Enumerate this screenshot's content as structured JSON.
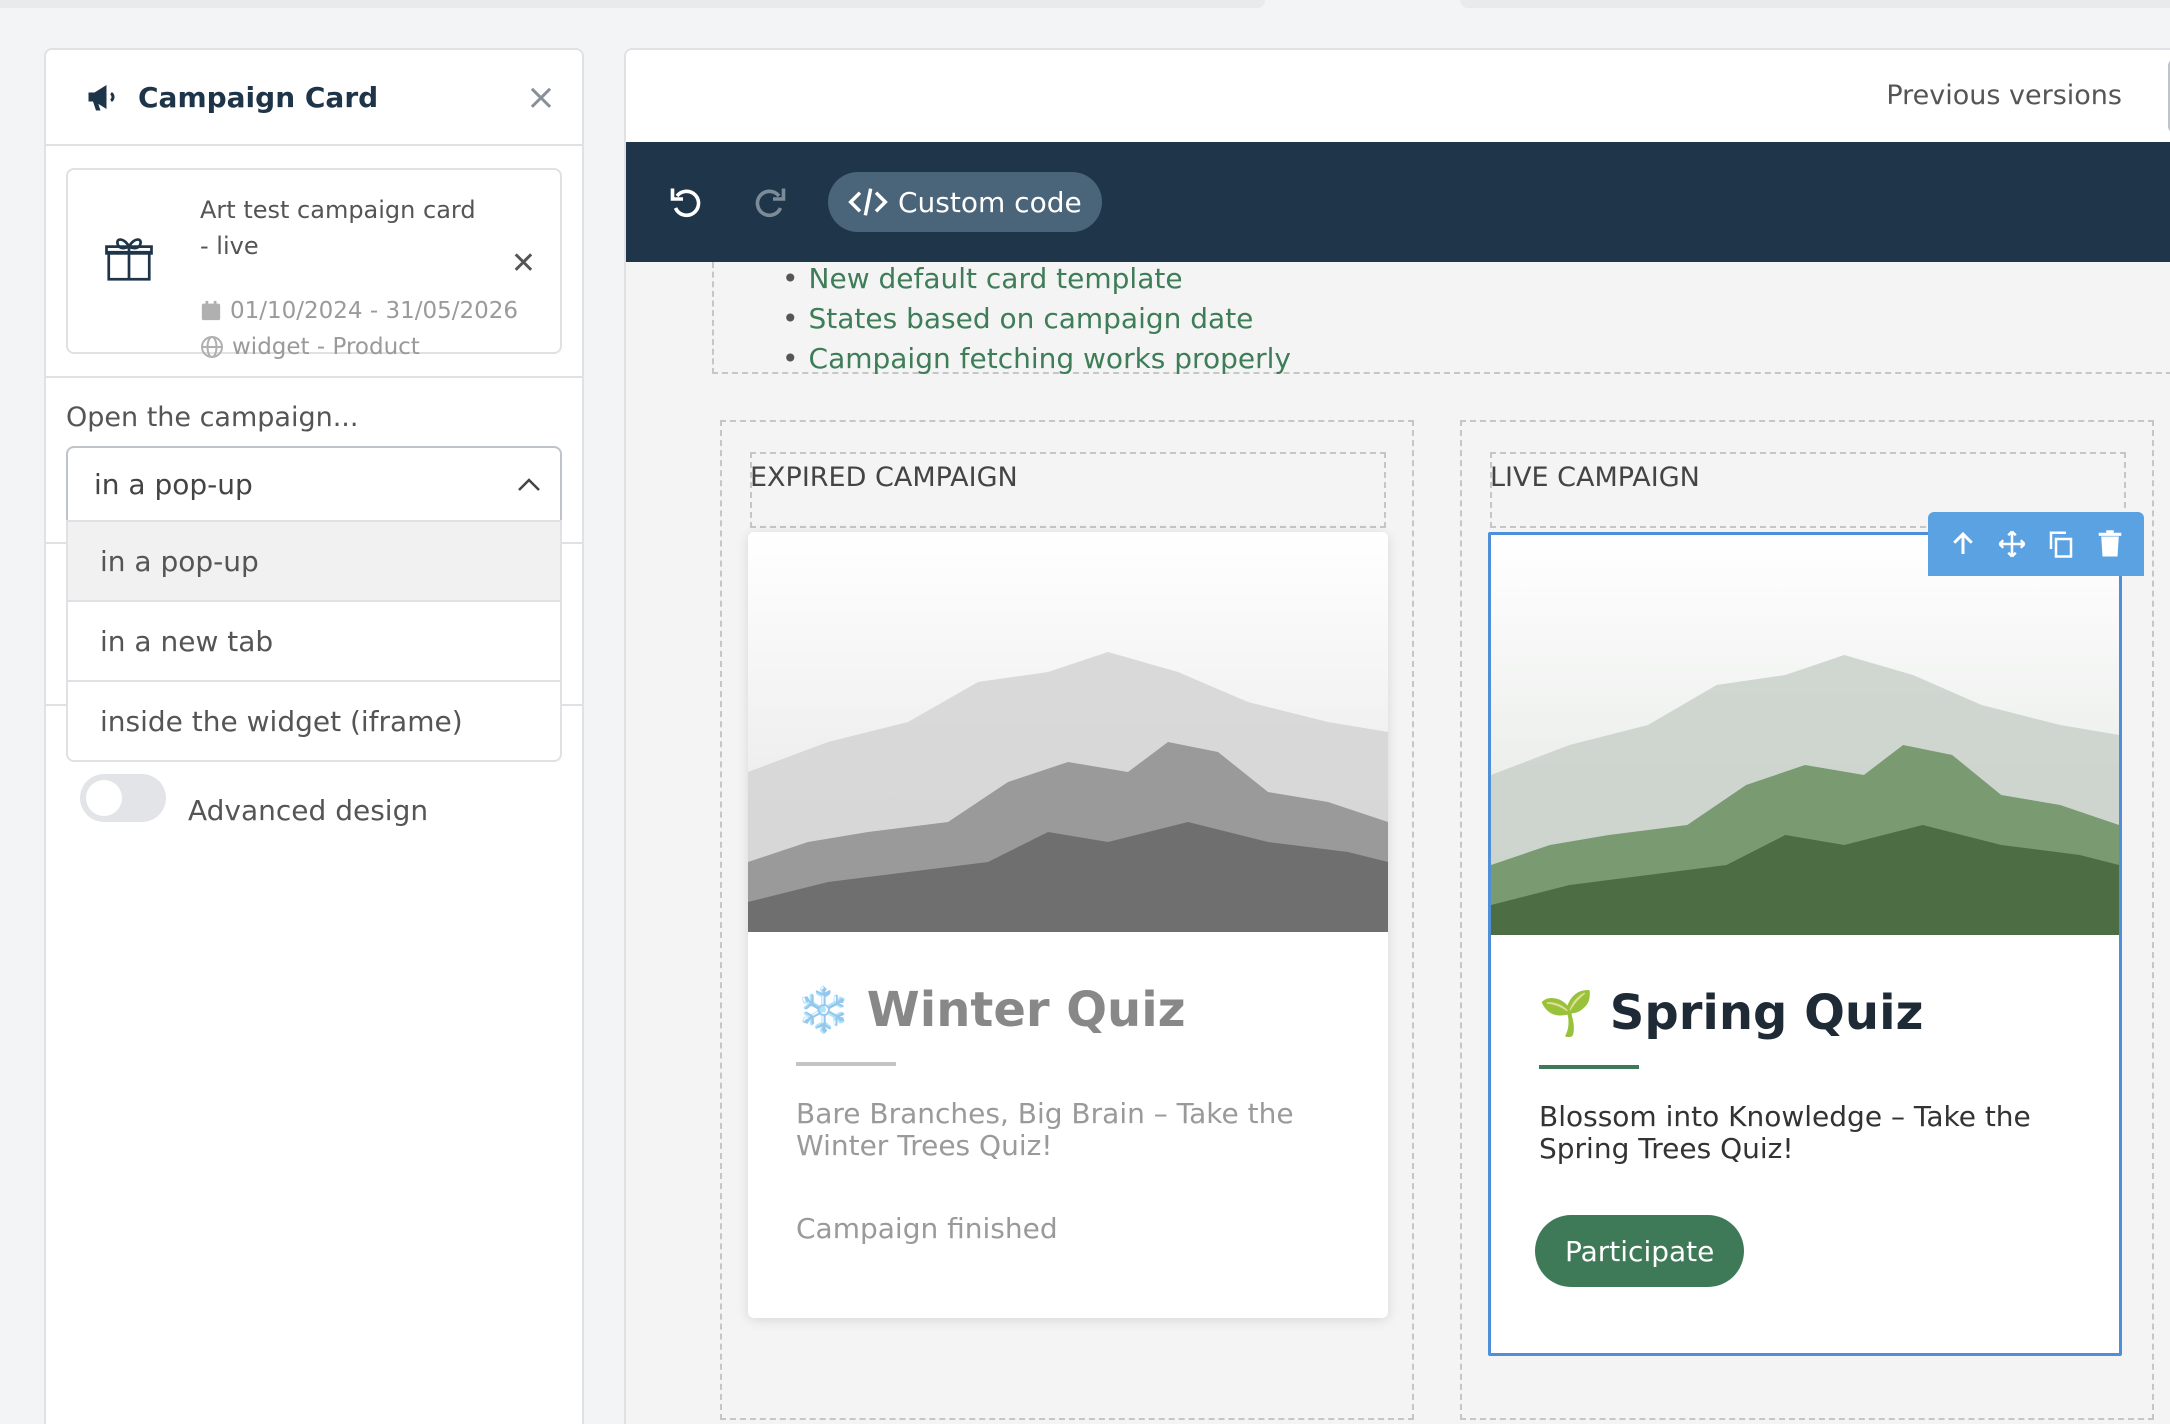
{
  "left_panel": {
    "title": "Campaign Card",
    "campaign": {
      "name": "Art test campaign card - live",
      "dates": "01/10/2024 - 31/05/2026",
      "widget": "widget - Product"
    },
    "open_label": "Open the campaign...",
    "select_value": "in a pop-up",
    "dropdown_options": [
      "in a pop-up",
      "in a new tab",
      "inside the widget (iframe)"
    ],
    "toggle_label": "Advanced design"
  },
  "right_panel": {
    "previous_versions": "Previous versions",
    "custom_code_label": "Custom code",
    "notes": [
      "New default card template",
      "States based on campaign date",
      "Campaign fetching works properly"
    ],
    "expired": {
      "section_label": "EXPIRED CAMPAIGN",
      "title": "Winter Quiz",
      "emoji": "❄️",
      "description": "Bare Branches, Big Brain – Take the Winter Trees Quiz!",
      "status": "Campaign finished"
    },
    "live": {
      "section_label": "LIVE CAMPAIGN",
      "title": "Spring Quiz",
      "emoji": "🌱",
      "description": "Blossom into Knowledge – Take the Spring Trees Quiz!",
      "button_label": "Participate"
    }
  },
  "colors": {
    "toolbar": "#1f364a",
    "accent_green": "#3f7a58",
    "selection_blue": "#5ba2e2",
    "note_green": "#3e7d57"
  }
}
